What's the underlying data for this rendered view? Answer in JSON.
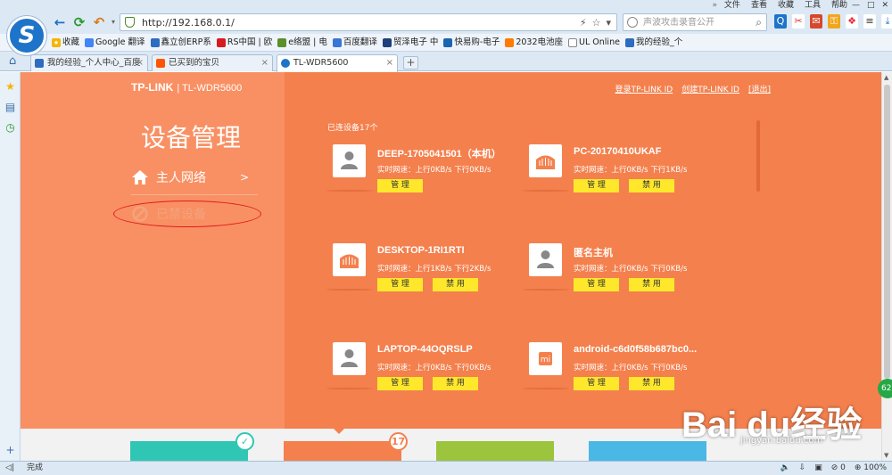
{
  "menubar": {
    "items": [
      "文件",
      "查看",
      "收藏",
      "工具",
      "帮助"
    ],
    "chevron": "»"
  },
  "nav": {
    "url": "http://192.168.0.1/",
    "search_placeholder": "声波攻击录音公开"
  },
  "bookmarks": [
    {
      "label": "收藏",
      "color": "#f5b400"
    },
    {
      "label": "Google 翻译",
      "color": "#4285f4"
    },
    {
      "label": "鑫立创ERP系",
      "color": "#2d6cc0"
    },
    {
      "label": "RS中国 | 欧",
      "color": "#d71920"
    },
    {
      "label": "e络盟 | 电",
      "color": "#5a8f2a"
    },
    {
      "label": "百度翻译",
      "color": "#3975d6"
    },
    {
      "label": "贸泽电子 中",
      "color": "#1f3e7c"
    },
    {
      "label": "快易购-电子",
      "color": "#1a66b3"
    },
    {
      "label": "2032电池座",
      "color": "#ff7a00"
    },
    {
      "label": "UL Online",
      "color": "#6a6a6a"
    },
    {
      "label": "我的经验_个",
      "color": "#2d6cc0"
    }
  ],
  "tabs": [
    {
      "label": "我的经验_个人中心_百度",
      "color": "#2d6cc0"
    },
    {
      "label": "已买到的宝贝",
      "color": "#ff5500"
    },
    {
      "label": "TL-WDR5600",
      "color": "#1d74c9"
    }
  ],
  "router": {
    "brand": "TP-LINK",
    "model": "| TL-WDR5600",
    "title": "设备管理",
    "menu_main": "主人网络",
    "menu_arrow": ">",
    "menu_blocked": "已禁设备",
    "link_login": "登录TP-LINK ID",
    "link_create": "创建TP-LINK ID",
    "link_exit": "[退出]",
    "connected": "已连设备17个",
    "btn_manage": "管 理",
    "btn_block": "禁 用",
    "devices": [
      {
        "name": "DEEP-1705041501（本机）",
        "speed": "实时网速：上行0KB/s  下行0KB/s",
        "icon": "person",
        "block": false
      },
      {
        "name": "PC-20170410UKAF",
        "speed": "实时网速：上行0KB/s  下行1KB/s",
        "icon": "router",
        "block": true
      },
      {
        "name": "DESKTOP-1RI1RTI",
        "speed": "实时网速：上行1KB/s  下行2KB/s",
        "icon": "router",
        "block": true
      },
      {
        "name": "匿名主机",
        "speed": "实时网速：上行0KB/s  下行0KB/s",
        "icon": "person",
        "block": true
      },
      {
        "name": "LAPTOP-44OQRSLP",
        "speed": "实时网速：上行0KB/s  下行0KB/s",
        "icon": "person",
        "block": true
      },
      {
        "name": "android-c6d0f58b687bc0...",
        "speed": "实时网速：上行0KB/s  下行0KB/s",
        "icon": "mi",
        "block": true
      }
    ],
    "badge_check": "✓",
    "badge_count": "17"
  },
  "watermark": {
    "text": "Bai du经验",
    "url": "jingyan.baidu.com",
    "float_badge": "62"
  },
  "status": {
    "left": "完成",
    "zoom": "100%",
    "count": "0"
  },
  "colors": {
    "left_panel": "#f99063",
    "main_panel": "#f4804d",
    "button": "#ffe82b"
  }
}
